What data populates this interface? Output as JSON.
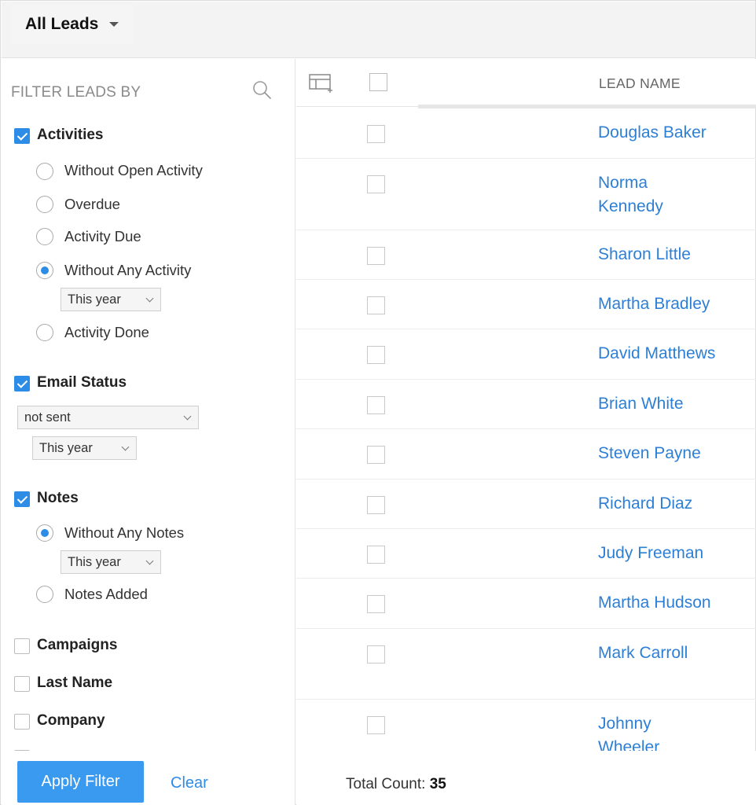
{
  "header": {
    "view_label": "All Leads"
  },
  "sidebar": {
    "title": "FILTER LEADS BY",
    "activities": {
      "label": "Activities",
      "checked": true,
      "options": [
        {
          "label": "Without Open Activity",
          "selected": false
        },
        {
          "label": "Overdue",
          "selected": false
        },
        {
          "label": "Activity Due",
          "selected": false
        },
        {
          "label": "Without Any Activity",
          "selected": true
        },
        {
          "label": "Activity Done",
          "selected": false
        }
      ],
      "period": "This year"
    },
    "email_status": {
      "label": "Email Status",
      "checked": true,
      "status": "not sent",
      "period": "This year"
    },
    "notes": {
      "label": "Notes",
      "checked": true,
      "options": [
        {
          "label": "Without Any Notes",
          "selected": true
        },
        {
          "label": "Notes Added",
          "selected": false
        }
      ],
      "period": "This year"
    },
    "more_filters": [
      {
        "label": "Campaigns",
        "checked": false
      },
      {
        "label": "Last Name",
        "checked": false
      },
      {
        "label": "Company",
        "checked": false
      }
    ],
    "apply_label": "Apply Filter",
    "clear_label": "Clear"
  },
  "table": {
    "column_header": "LEAD NAME",
    "rows": [
      {
        "name": "Douglas Baker"
      },
      {
        "name": "Norma Kennedy"
      },
      {
        "name": "Sharon Little"
      },
      {
        "name": "Martha Bradley"
      },
      {
        "name": "David Matthews"
      },
      {
        "name": "Brian White"
      },
      {
        "name": "Steven Payne"
      },
      {
        "name": "Richard Diaz"
      },
      {
        "name": "Judy Freeman"
      },
      {
        "name": "Martha Hudson"
      },
      {
        "name": "Mark Carroll"
      },
      {
        "name": "Johnny Wheeler"
      }
    ],
    "total_label": "Total Count:",
    "total_count": "35"
  },
  "colors": {
    "accent": "#2d8ce6",
    "button": "#3a9af0",
    "link": "#2d7fd6"
  }
}
